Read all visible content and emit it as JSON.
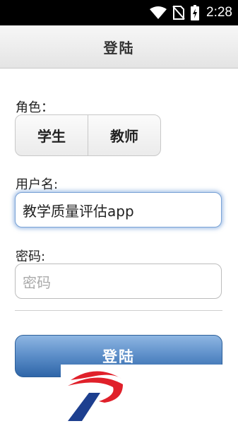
{
  "status_bar": {
    "time": "2:28"
  },
  "header": {
    "title": "登陆"
  },
  "role": {
    "label": "角色：",
    "options": [
      "学生",
      "教师"
    ]
  },
  "username": {
    "label": "用户名:",
    "value": "教学质量评估app"
  },
  "password": {
    "label": "密码:",
    "placeholder": "密码"
  },
  "login_button": {
    "label": "登陆"
  },
  "colors": {
    "accent": "#2f66a8",
    "logo_red": "#e0202a",
    "logo_blue": "#1d3f8f"
  },
  "icons": [
    "wifi-icon",
    "no-sim-icon",
    "battery-charging-icon",
    "brand-logo-icon"
  ]
}
